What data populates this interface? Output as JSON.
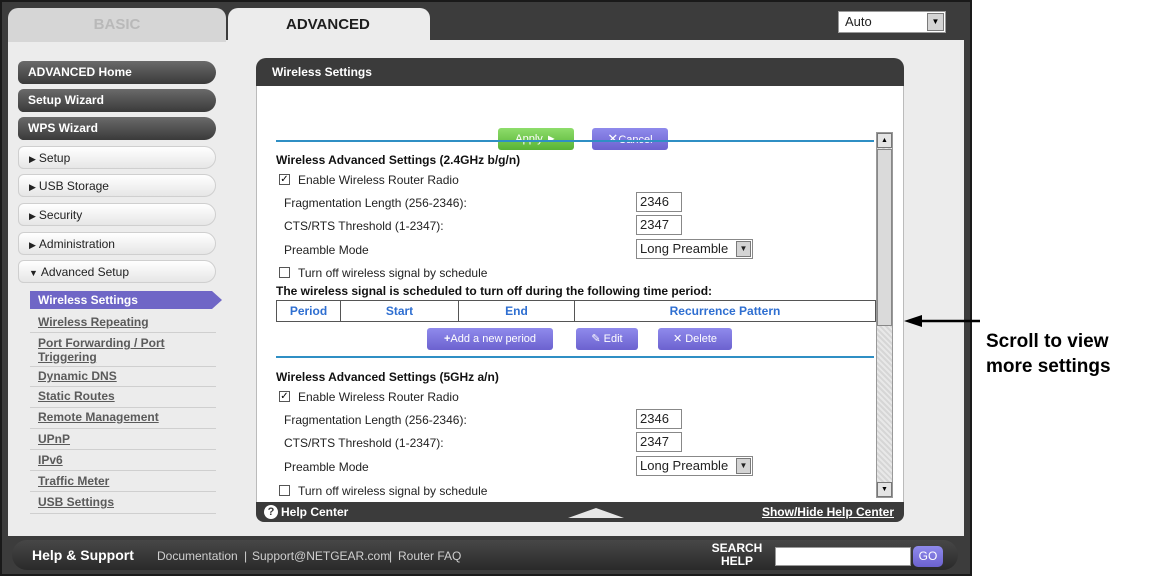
{
  "tabs": {
    "basic": "BASIC",
    "advanced": "ADVANCED"
  },
  "language_select": {
    "value": "Auto"
  },
  "sidebar": {
    "main_items": [
      "ADVANCED Home",
      "Setup Wizard",
      "WPS Wizard"
    ],
    "menu_items": [
      "Setup",
      "USB Storage",
      "Security",
      "Administration",
      "Advanced Setup"
    ],
    "sub_items": [
      "Wireless Settings",
      "Wireless Repeating",
      "Port Forwarding / Port",
      "Triggering",
      "Dynamic DNS",
      "Static Routes",
      "Remote Management",
      "UPnP",
      "IPv6",
      "Traffic Meter",
      "USB Settings"
    ]
  },
  "panel": {
    "title": "Wireless Settings",
    "apply_label": "Apply ►",
    "cancel_label": "Cancel",
    "section_24": {
      "title": "Wireless Advanced Settings (2.4GHz b/g/n)",
      "enable_radio": "Enable Wireless Router Radio",
      "frag_label": "Fragmentation Length (256-2346):",
      "frag_value": "2346",
      "cts_label": "CTS/RTS Threshold (1-2347):",
      "cts_value": "2347",
      "preamble_label": "Preamble Mode",
      "preamble_value": "Long Preamble",
      "schedule_off": "Turn off wireless signal by schedule",
      "schedule_note": "The wireless signal is scheduled to turn off during the following time period:",
      "table_headers": [
        "Period",
        "Start",
        "End",
        "Recurrence Pattern"
      ],
      "add_period": "Add a new period",
      "edit": "Edit",
      "delete": "Delete"
    },
    "section_5": {
      "title": "Wireless Advanced Settings (5GHz a/n)",
      "enable_radio": "Enable Wireless Router Radio",
      "frag_label": "Fragmentation Length (256-2346):",
      "frag_value": "2346",
      "cts_label": "CTS/RTS Threshold (1-2347):",
      "cts_value": "2347",
      "preamble_label": "Preamble Mode",
      "preamble_value": "Long Preamble",
      "schedule_off": "Turn off wireless signal by schedule"
    },
    "footer": {
      "help_center": "Help Center",
      "show_hide": "Show/Hide Help Center"
    }
  },
  "help_bar": {
    "title": "Help & Support",
    "documentation": "Documentation",
    "support_email": "Support@NETGEAR.com",
    "faq": "Router FAQ",
    "search_line1": "SEARCH",
    "search_line2": "HELP",
    "go": "GO"
  },
  "callout": {
    "line1": "Scroll to view",
    "line2": "more settings"
  },
  "colors": {
    "accent_purple": "#6c62cf",
    "accent_green": "#58b335",
    "rule_blue": "#2f8fc4",
    "header_dark": "#3b3b3b"
  }
}
